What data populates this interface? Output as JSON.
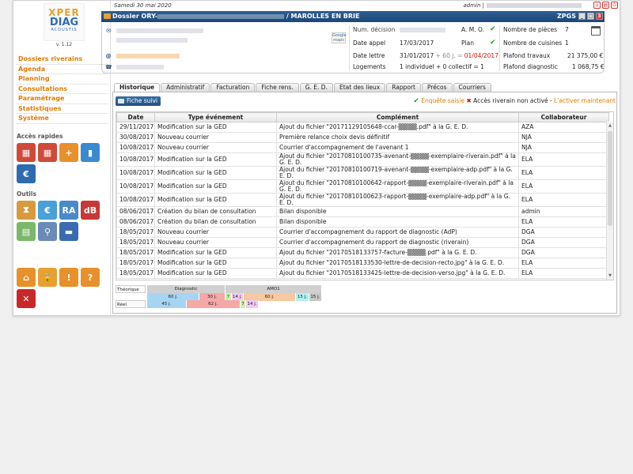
{
  "app": {
    "logo_line1": "XPER",
    "logo_line2": "DIAG",
    "logo_line3": "ACOUSTIS",
    "version": "v. 1.12"
  },
  "topbar": {
    "date": "Samedi 30 mai 2020",
    "user": "admin |"
  },
  "sidebar": {
    "menu": [
      "Dossiers riverains",
      "Agenda",
      "Planning",
      "Consultations",
      "Paramétrage",
      "Statistiques",
      "Système"
    ],
    "quick_access_title": "Accès rapides",
    "tools_title": "Outils",
    "quick_icons": [
      {
        "name": "calendar-clock-icon",
        "color": "#d04a3a",
        "glyph": "▦"
      },
      {
        "name": "calendar-check-icon",
        "color": "#d04a3a",
        "glyph": "▦"
      },
      {
        "name": "folder-add-icon",
        "color": "#e8902a",
        "glyph": "+"
      },
      {
        "name": "bar-chart-icon",
        "color": "#3a8ad0",
        "glyph": "▮"
      },
      {
        "name": "euro-calculator-icon",
        "color": "#2e6bb0",
        "glyph": "€"
      }
    ],
    "tool_icons": [
      {
        "name": "hourglass-icon",
        "color": "#d89a40",
        "glyph": "⧗"
      },
      {
        "name": "euro-grid-icon",
        "color": "#4aa0d8",
        "glyph": "€"
      },
      {
        "name": "ra-grid-icon",
        "color": "#4a8ac8",
        "glyph": "RA"
      },
      {
        "name": "house-db-icon",
        "color": "#c83838",
        "glyph": "dB"
      },
      {
        "name": "map-grid-icon",
        "color": "#7ab86a",
        "glyph": "▤"
      },
      {
        "name": "location-pin-icon",
        "color": "#6a8ab8",
        "glyph": "⚲"
      },
      {
        "name": "truck-icon",
        "color": "#3a6ab0",
        "glyph": "▬"
      }
    ],
    "bottom_icons": [
      {
        "name": "home-icon",
        "color": "#e8902a",
        "glyph": "⌂"
      },
      {
        "name": "lock-icon",
        "color": "#e8a030",
        "glyph": "🔒"
      },
      {
        "name": "warning-icon",
        "color": "#e8902a",
        "glyph": "!"
      },
      {
        "name": "help-icon",
        "color": "#e8902a",
        "glyph": "?"
      },
      {
        "name": "close-icon",
        "color": "#c82828",
        "glyph": "✕"
      }
    ]
  },
  "dossier": {
    "prefix": "Dossier ORY-",
    "location": "/ MAROLLES EN BRIE",
    "code": "ZPGS",
    "maps_label": "Google maps"
  },
  "info": {
    "num_decision_label": "Num. décision",
    "date_appel_label": "Date appel",
    "date_appel_value": "17/03/2017",
    "date_lettre_label": "Date lettre",
    "date_lettre_value": "31/01/2017",
    "date_lettre_extra": "+ 60 j. =",
    "date_lettre_result": "01/04/2017",
    "logements_label": "Logements",
    "logements_value": "1 individuel + 0 collectif = 1",
    "amo_label": "A. M. O.",
    "plan_label": "Plan",
    "pieces_label": "Nombre de pièces",
    "pieces_value": "7",
    "cuisines_label": "Nombre de cuisines",
    "cuisines_value": "1",
    "plafond_travaux_label": "Plafond travaux",
    "plafond_travaux_value": "21 375,00 €",
    "plafond_diag_label": "Plafond diagnostic",
    "plafond_diag_value": "1 068,75 €"
  },
  "tabs": [
    "Historique",
    "Administratif",
    "Facturation",
    "Fiche rens.",
    "G. E. D.",
    "Etat des lieux",
    "Rapport",
    "Précos",
    "Courriers"
  ],
  "panel": {
    "fiche_suivi": "Fiche suivi",
    "enquete": "Enquête saisie",
    "acces": "Accès riverain non activé -",
    "activer": "L'activer maintenant"
  },
  "table": {
    "headers": [
      "Date",
      "Type événement",
      "Complément",
      "Collaborateur"
    ],
    "rows": [
      {
        "date": "29/11/2017",
        "type": "Modification sur la GED",
        "comp": "Ajout du fichier \"20171129105648-ccar-▒▒▒▒.pdf\" à la G. E. D.",
        "collab": "AZA",
        "tall": false
      },
      {
        "date": "30/08/2017",
        "type": "Nouveau courrier",
        "comp": "Première relance choix devis définitif",
        "collab": "NJA",
        "tall": false
      },
      {
        "date": "10/08/2017",
        "type": "Nouveau courrier",
        "comp": "Courrier d'accompagnement de l'avenant 1",
        "collab": "NJA",
        "tall": false
      },
      {
        "date": "10/08/2017",
        "type": "Modification sur la GED",
        "comp": "Ajout du fichier \"20170810100735-avenant-▒▒▒▒-exemplaire-riverain.pdf\" à la G. E. D.",
        "collab": "ELA",
        "tall": true
      },
      {
        "date": "10/08/2017",
        "type": "Modification sur la GED",
        "comp": "Ajout du fichier \"20170810100719-avenant-▒▒▒▒-exemplaire-adp.pdf\" à la G. E. D.",
        "collab": "ELA",
        "tall": true
      },
      {
        "date": "10/08/2017",
        "type": "Modification sur la GED",
        "comp": "Ajout du fichier \"20170810100642-rapport-▒▒▒▒-exemplaire-riverain.pdf\" à la G. E. D.",
        "collab": "ELA",
        "tall": true
      },
      {
        "date": "10/08/2017",
        "type": "Modification sur la GED",
        "comp": "Ajout du fichier \"20170810100623-rapport-▒▒▒▒-exemplaire-adp.pdf\" à la G. E. D.",
        "collab": "ELA",
        "tall": false
      },
      {
        "date": "08/06/2017",
        "type": "Création du bilan de consultation",
        "comp": "Bilan disponible",
        "collab": "admin",
        "tall": false
      },
      {
        "date": "08/06/2017",
        "type": "Création du bilan de consultation",
        "comp": "Bilan disponible",
        "collab": "ELA",
        "tall": false
      },
      {
        "date": "18/05/2017",
        "type": "Nouveau courrier",
        "comp": "Courrier d'accompagnement du rapport de diagnostic (AdP)",
        "collab": "DGA",
        "tall": false
      },
      {
        "date": "18/05/2017",
        "type": "Nouveau courrier",
        "comp": "Courrier d'accompagnement du rapport de diagnostic (riverain)",
        "collab": "DGA",
        "tall": false
      },
      {
        "date": "18/05/2017",
        "type": "Modification sur la GED",
        "comp": "Ajout du fichier \"20170518133757-facture-▒▒▒▒.pdf\" à la G. E. D.",
        "collab": "DGA",
        "tall": false
      },
      {
        "date": "18/05/2017",
        "type": "Modification sur la GED",
        "comp": "Ajout du fichier \"20170518133530-lettre-de-decision-recto.jpg\" à la G. E. D.",
        "collab": "ELA",
        "tall": false
      },
      {
        "date": "18/05/2017",
        "type": "Modification sur la GED",
        "comp": "Ajout du fichier \"20170518133425-lettre-de-decision-verso.jpg\" à la G. E. D.",
        "collab": "ELA",
        "tall": false
      }
    ]
  },
  "planning": {
    "theorique_label": "Théorique",
    "reel_label": "Réel",
    "phases": [
      {
        "label": "Diagnostic",
        "color": "#d0d0d0"
      },
      {
        "label": "AMO1",
        "color": "#d0d0d0"
      }
    ],
    "theorique": [
      {
        "label": "60 j.",
        "days": 60,
        "color": "#a8d4f4"
      },
      {
        "label": "30 j.",
        "days": 30,
        "color": "#f4a8a8"
      },
      {
        "label": "7 j.",
        "days": 7,
        "color": "#c8f4a8"
      },
      {
        "label": "14 j.",
        "days": 14,
        "color": "#f4c8f4"
      },
      {
        "label": "60 j.",
        "days": 60,
        "color": "#f8c8a0"
      },
      {
        "label": "15 j.",
        "days": 15,
        "color": "#b0f0f0"
      },
      {
        "label": "15 j.",
        "days": 15,
        "color": "#c8c8c8"
      }
    ],
    "reel": [
      {
        "label": "45 j.",
        "days": 45,
        "color": "#a8d4f4"
      },
      {
        "label": "62 j.",
        "days": 62,
        "color": "#f4a8a8"
      },
      {
        "label": "7 j.",
        "days": 7,
        "color": "#c8f4a8"
      },
      {
        "label": "14 j.",
        "days": 14,
        "color": "#f4c8f4"
      }
    ]
  }
}
